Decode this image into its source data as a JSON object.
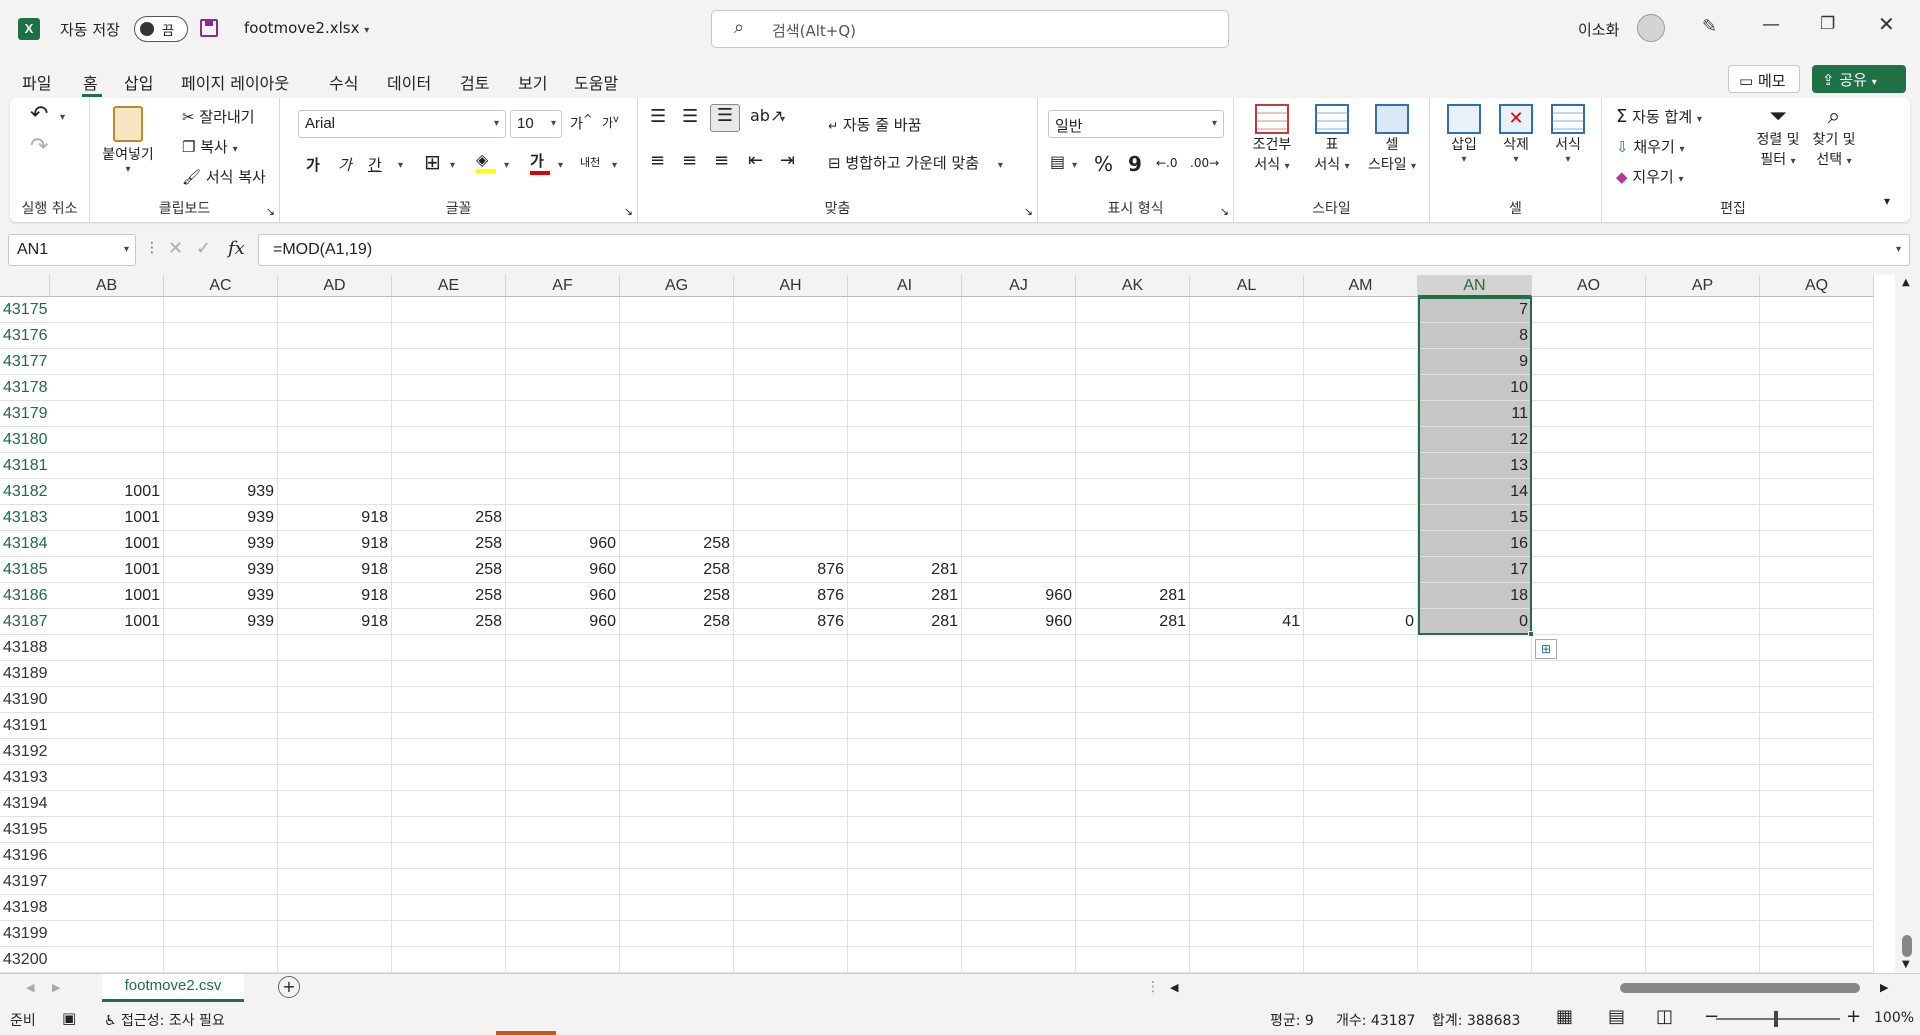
{
  "titlebar": {
    "autosave_label": "자동 저장",
    "autosave_state": "끔",
    "filename": "footmove2.xlsx",
    "search_placeholder": "검색(Alt+Q)",
    "user_name": "이소화"
  },
  "menu": {
    "items": [
      "파일",
      "홈",
      "삽입",
      "페이지 레이아웃",
      "수식",
      "데이터",
      "검토",
      "보기",
      "도움말"
    ],
    "active": "홈",
    "memo_label": "메모",
    "share_label": "공유"
  },
  "ribbon": {
    "undo_group": "실행 취소",
    "clipboard": {
      "label": "클립보드",
      "paste": "붙여넣기",
      "cut": "잘라내기",
      "copy": "복사",
      "format_painter": "서식 복사"
    },
    "font": {
      "label": "글꼴",
      "font_name": "Arial",
      "font_size": "10",
      "bold": "가",
      "italic": "가",
      "underline": "간",
      "color_sample": "가",
      "phonetic": "내천"
    },
    "alignment": {
      "label": "맞춤",
      "wrap_text": "자동 줄 바꿈",
      "merge_center": "병합하고 가운데 맞춤"
    },
    "number": {
      "label": "표시 형식",
      "format": "일반",
      "percent": "%",
      "comma": "9"
    },
    "styles": {
      "label": "스타일",
      "conditional": [
        "조건부",
        "서식"
      ],
      "table": [
        "표",
        "서식"
      ],
      "cell_styles": [
        "셀",
        "스타일"
      ]
    },
    "cells": {
      "label": "셀",
      "insert": "삽입",
      "delete": "삭제",
      "format": "서식"
    },
    "editing": {
      "label": "편집",
      "autosum": "자동 합계",
      "fill": "채우기",
      "clear": "지우기",
      "sort": [
        "정렬 및",
        "필터"
      ],
      "find": [
        "찾기 및",
        "선택"
      ]
    }
  },
  "formula_bar": {
    "name_box": "AN1",
    "formula": "=MOD(A1,19)"
  },
  "grid": {
    "columns": [
      "AB",
      "AC",
      "AD",
      "AE",
      "AF",
      "AG",
      "AH",
      "AI",
      "AJ",
      "AK",
      "AL",
      "AM",
      "AN",
      "AO",
      "AP",
      "AQ"
    ],
    "selected_column": "AN",
    "rows": [
      {
        "n": "43175",
        "sel": true,
        "cells": [
          "",
          "",
          "",
          "",
          "",
          "",
          "",
          "",
          "",
          "",
          "",
          "",
          "7",
          "",
          "",
          ""
        ]
      },
      {
        "n": "43176",
        "sel": true,
        "cells": [
          "",
          "",
          "",
          "",
          "",
          "",
          "",
          "",
          "",
          "",
          "",
          "",
          "8",
          "",
          "",
          ""
        ]
      },
      {
        "n": "43177",
        "sel": true,
        "cells": [
          "",
          "",
          "",
          "",
          "",
          "",
          "",
          "",
          "",
          "",
          "",
          "",
          "9",
          "",
          "",
          ""
        ]
      },
      {
        "n": "43178",
        "sel": true,
        "cells": [
          "",
          "",
          "",
          "",
          "",
          "",
          "",
          "",
          "",
          "",
          "",
          "",
          "10",
          "",
          "",
          ""
        ]
      },
      {
        "n": "43179",
        "sel": true,
        "cells": [
          "",
          "",
          "",
          "",
          "",
          "",
          "",
          "",
          "",
          "",
          "",
          "",
          "11",
          "",
          "",
          ""
        ]
      },
      {
        "n": "43180",
        "sel": true,
        "cells": [
          "",
          "",
          "",
          "",
          "",
          "",
          "",
          "",
          "",
          "",
          "",
          "",
          "12",
          "",
          "",
          ""
        ]
      },
      {
        "n": "43181",
        "sel": true,
        "cells": [
          "",
          "",
          "",
          "",
          "",
          "",
          "",
          "",
          "",
          "",
          "",
          "",
          "13",
          "",
          "",
          ""
        ]
      },
      {
        "n": "43182",
        "sel": true,
        "cells": [
          "1001",
          "939",
          "",
          "",
          "",
          "",
          "",
          "",
          "",
          "",
          "",
          "",
          "14",
          "",
          "",
          ""
        ]
      },
      {
        "n": "43183",
        "sel": true,
        "cells": [
          "1001",
          "939",
          "918",
          "258",
          "",
          "",
          "",
          "",
          "",
          "",
          "",
          "",
          "15",
          "",
          "",
          ""
        ]
      },
      {
        "n": "43184",
        "sel": true,
        "cells": [
          "1001",
          "939",
          "918",
          "258",
          "960",
          "258",
          "",
          "",
          "",
          "",
          "",
          "",
          "16",
          "",
          "",
          ""
        ]
      },
      {
        "n": "43185",
        "sel": true,
        "cells": [
          "1001",
          "939",
          "918",
          "258",
          "960",
          "258",
          "876",
          "281",
          "",
          "",
          "",
          "",
          "17",
          "",
          "",
          ""
        ]
      },
      {
        "n": "43186",
        "sel": true,
        "cells": [
          "1001",
          "939",
          "918",
          "258",
          "960",
          "258",
          "876",
          "281",
          "960",
          "281",
          "",
          "",
          "18",
          "",
          "",
          ""
        ]
      },
      {
        "n": "43187",
        "sel": true,
        "cells": [
          "1001",
          "939",
          "918",
          "258",
          "960",
          "258",
          "876",
          "281",
          "960",
          "281",
          "41",
          "0",
          "0",
          "",
          "",
          ""
        ]
      },
      {
        "n": "43188",
        "sel": false,
        "cells": [
          "",
          "",
          "",
          "",
          "",
          "",
          "",
          "",
          "",
          "",
          "",
          "",
          "",
          "",
          "",
          ""
        ]
      },
      {
        "n": "43189",
        "sel": false,
        "cells": [
          "",
          "",
          "",
          "",
          "",
          "",
          "",
          "",
          "",
          "",
          "",
          "",
          "",
          "",
          "",
          ""
        ]
      },
      {
        "n": "43190",
        "sel": false,
        "cells": [
          "",
          "",
          "",
          "",
          "",
          "",
          "",
          "",
          "",
          "",
          "",
          "",
          "",
          "",
          "",
          ""
        ]
      },
      {
        "n": "43191",
        "sel": false,
        "cells": [
          "",
          "",
          "",
          "",
          "",
          "",
          "",
          "",
          "",
          "",
          "",
          "",
          "",
          "",
          "",
          ""
        ]
      },
      {
        "n": "43192",
        "sel": false,
        "cells": [
          "",
          "",
          "",
          "",
          "",
          "",
          "",
          "",
          "",
          "",
          "",
          "",
          "",
          "",
          "",
          ""
        ]
      },
      {
        "n": "43193",
        "sel": false,
        "cells": [
          "",
          "",
          "",
          "",
          "",
          "",
          "",
          "",
          "",
          "",
          "",
          "",
          "",
          "",
          "",
          ""
        ]
      },
      {
        "n": "43194",
        "sel": false,
        "cells": [
          "",
          "",
          "",
          "",
          "",
          "",
          "",
          "",
          "",
          "",
          "",
          "",
          "",
          "",
          "",
          ""
        ]
      },
      {
        "n": "43195",
        "sel": false,
        "cells": [
          "",
          "",
          "",
          "",
          "",
          "",
          "",
          "",
          "",
          "",
          "",
          "",
          "",
          "",
          "",
          ""
        ]
      },
      {
        "n": "43196",
        "sel": false,
        "cells": [
          "",
          "",
          "",
          "",
          "",
          "",
          "",
          "",
          "",
          "",
          "",
          "",
          "",
          "",
          "",
          ""
        ]
      },
      {
        "n": "43197",
        "sel": false,
        "cells": [
          "",
          "",
          "",
          "",
          "",
          "",
          "",
          "",
          "",
          "",
          "",
          "",
          "",
          "",
          "",
          ""
        ]
      },
      {
        "n": "43198",
        "sel": false,
        "cells": [
          "",
          "",
          "",
          "",
          "",
          "",
          "",
          "",
          "",
          "",
          "",
          "",
          "",
          "",
          "",
          ""
        ]
      },
      {
        "n": "43199",
        "sel": false,
        "cells": [
          "",
          "",
          "",
          "",
          "",
          "",
          "",
          "",
          "",
          "",
          "",
          "",
          "",
          "",
          "",
          ""
        ]
      },
      {
        "n": "43200",
        "sel": false,
        "cells": [
          "",
          "",
          "",
          "",
          "",
          "",
          "",
          "",
          "",
          "",
          "",
          "",
          "",
          "",
          "",
          ""
        ]
      }
    ]
  },
  "sheet_tabs": {
    "active": "footmove2.csv"
  },
  "status": {
    "ready": "준비",
    "accessibility": "접근성: 조사 필요",
    "average": "평균: 9",
    "count": "개수: 43187",
    "sum": "합계: 388683",
    "zoom": "100%"
  },
  "colors": {
    "excel_green": "#1e7145",
    "selection_gray": "#c6c6c6",
    "header_green": "#1e6e3d"
  }
}
